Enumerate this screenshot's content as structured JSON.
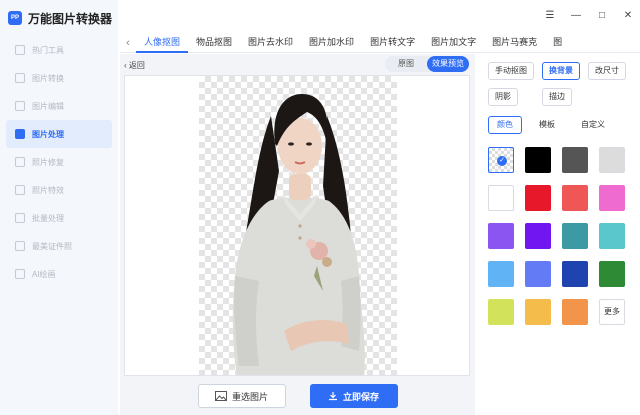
{
  "app": {
    "title": "万能图片转换器",
    "logo_text": "PP"
  },
  "window_controls": {
    "menu": "☰",
    "minimize": "—",
    "maximize": "□",
    "close": "✕"
  },
  "sidebar": {
    "items": [
      {
        "label": "热门工具",
        "icon": "fire-icon"
      },
      {
        "label": "图片转换",
        "icon": "convert-icon"
      },
      {
        "label": "图片编辑",
        "icon": "edit-icon"
      },
      {
        "label": "图片处理",
        "icon": "process-icon",
        "active": true
      },
      {
        "label": "照片修复",
        "icon": "repair-icon"
      },
      {
        "label": "照片特效",
        "icon": "effect-icon"
      },
      {
        "label": "批量处理",
        "icon": "batch-icon"
      },
      {
        "label": "最美证件照",
        "icon": "id-photo-icon"
      },
      {
        "label": "AI绘画",
        "icon": "ai-paint-icon"
      }
    ]
  },
  "tabs": [
    {
      "label": "人像抠图",
      "active": true
    },
    {
      "label": "物品抠图"
    },
    {
      "label": "图片去水印"
    },
    {
      "label": "图片加水印"
    },
    {
      "label": "图片转文字"
    },
    {
      "label": "图片加文字"
    },
    {
      "label": "图片马赛克"
    },
    {
      "label": "图"
    }
  ],
  "main": {
    "back_label": "返回",
    "view_toggle": {
      "original": "原图",
      "preview": "效果预览",
      "selected": "效果预览"
    },
    "reselect_label": "重选图片",
    "save_label": "立即保存"
  },
  "panel": {
    "options_row1": [
      "手动抠图",
      "换背景",
      "改尺寸"
    ],
    "options_row2": [
      "阴影",
      "描边"
    ],
    "selected_option": "换背景",
    "subtabs": [
      "颜色",
      "模板",
      "自定义"
    ],
    "selected_subtab": "颜色",
    "swatches": [
      "transparent",
      "#000000",
      "#555555",
      "#dcdcdc",
      "#ffffff",
      "#e8182b",
      "#ef5656",
      "#f06bd0",
      "#8a55f0",
      "#7116f0",
      "#3c9aa5",
      "#5ac7cd",
      "#60b3f5",
      "#637cf5",
      "#1f44b0",
      "#2e8a35",
      "#d2e25a",
      "#f4bd4b",
      "#f2944a",
      "more"
    ],
    "selected_swatch": "transparent",
    "more_label": "更多"
  },
  "colors": {
    "accent": "#2f6df5",
    "sidebar_bg": "#f4f7fc",
    "main_bg": "#f2f4f8"
  }
}
